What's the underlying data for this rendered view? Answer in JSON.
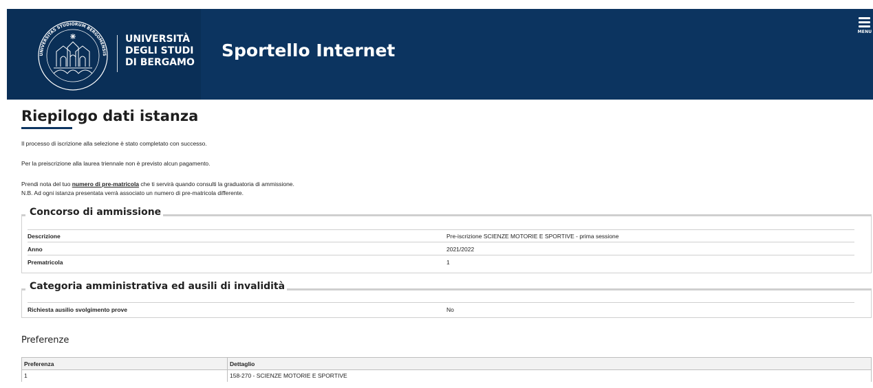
{
  "header": {
    "univ_line1": "UNIVERSITÀ",
    "univ_line2": "DEGLI STUDI",
    "univ_line3": "DI BERGAMO",
    "app_title": "Sportello Internet",
    "menu_label": "MENU",
    "seal_text": "UNIVERSITAS STUDIORUM BERGOMENSIS",
    "colors": {
      "header_bg": "#0c3460",
      "brand_bg": "#0a2f57"
    }
  },
  "page": {
    "title": "Riepilogo dati istanza",
    "messages": {
      "completed": "Il processo di iscrizione alla selezione è stato completato con successo.",
      "no_payment": "Per la preiscrizione alla laurea triennale non è previsto alcun pagamento.",
      "note_before": "Prendi nota del tuo ",
      "note_link": "numero di pre-matricola",
      "note_after": " che ti servirà quando consulti la graduatoria di ammissione.",
      "nb": "N.B. Ad ogni istanza presentata verrà associato un numero di pre-matricola differente."
    }
  },
  "concorso": {
    "legend": "Concorso di ammissione",
    "rows": [
      {
        "label": "Descrizione",
        "value": "Pre-iscrizione SCIENZE MOTORIE E SPORTIVE - prima sessione"
      },
      {
        "label": "Anno",
        "value": "2021/2022"
      },
      {
        "label": "Prematricola",
        "value": "1"
      }
    ]
  },
  "categoria": {
    "legend": "Categoria amministrativa ed ausili di invalidità",
    "rows": [
      {
        "label": "Richiesta ausilio svolgimento prove",
        "value": "No"
      }
    ]
  },
  "preferenze": {
    "heading": "Preferenze",
    "columns": [
      "Preferenza",
      "Dettaglio"
    ],
    "rows": [
      {
        "preferenza": "1",
        "dettaglio": "158-270 - SCIENZE MOTORIE E SPORTIVE"
      }
    ]
  }
}
